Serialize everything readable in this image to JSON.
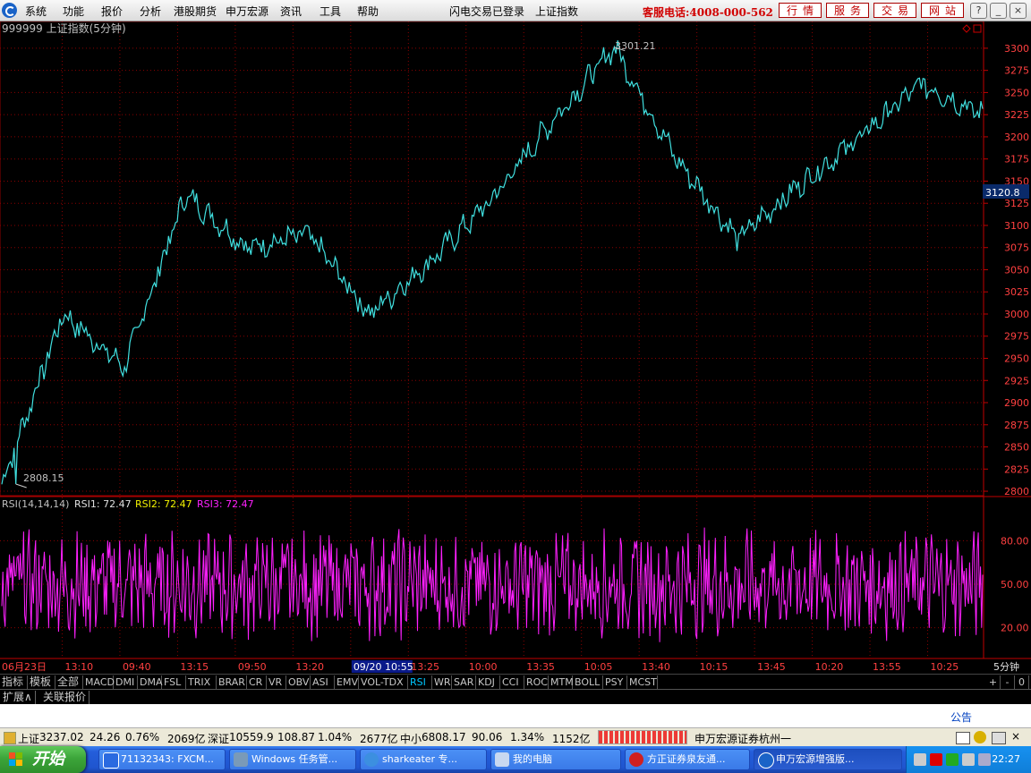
{
  "menu": {
    "items": [
      "系统",
      "功能",
      "报价",
      "分析",
      "港股期货",
      "申万宏源",
      "资讯",
      "工具",
      "帮助"
    ],
    "login_status": "闪电交易已登录",
    "index_name": "上证指数",
    "hotline": "客服电话:4008-000-562",
    "service_buttons": [
      "行情",
      "服务",
      "交易",
      "网站"
    ]
  },
  "chart": {
    "title": "999999 上证指数(5分钟)",
    "price_high_label": "3301.21",
    "price_low_label": "2808.15",
    "current_price": "3120.8",
    "indicator_legend": {
      "name": "RSI(14,14,14)",
      "rsi1": "RSI1: 72.47",
      "rsi2": "RSI2: 72.47",
      "rsi3": "RSI3: 72.47"
    },
    "period_label": "5分钟",
    "time_labels": [
      "06月23日",
      "13:10",
      "09:40",
      "13:15",
      "09:50",
      "13:20",
      "09/20 10:55",
      "13:25",
      "10:00",
      "13:35",
      "10:05",
      "13:40",
      "10:15",
      "13:45",
      "10:20",
      "13:55",
      "10:25"
    ]
  },
  "chart_data": {
    "type": "line",
    "title": "999999 上证指数(5分钟)",
    "price_axis": {
      "ticks": [
        2800,
        2825,
        2850,
        2875,
        2900,
        2925,
        2950,
        2975,
        3000,
        3025,
        3050,
        3075,
        3100,
        3125,
        3150,
        3175,
        3200,
        3225,
        3250,
        3275,
        3300
      ],
      "ylim": [
        2795,
        3310
      ]
    },
    "series": [
      {
        "name": "上证指数",
        "x": [
          "06月23日",
          "13:10",
          "09:40",
          "13:15",
          "09:50",
          "13:20",
          "09/20 10:55",
          "13:25",
          "10:00",
          "13:35",
          "10:05",
          "13:40",
          "10:15",
          "13:45",
          "10:20",
          "13:55",
          "10:25"
        ],
        "values": [
          2808,
          3000,
          2940,
          3135,
          3075,
          3090,
          3000,
          3060,
          3130,
          3220,
          3301,
          3175,
          3085,
          3145,
          3200,
          3260,
          3225
        ],
        "color": "#40e0e0"
      }
    ],
    "annotations": [
      {
        "label": "3301.21",
        "value": 3301.21
      },
      {
        "label": "2808.15",
        "value": 2808.15
      },
      {
        "label": "3120.8",
        "value": 3120.8
      }
    ],
    "rsi": {
      "name": "RSI(14,14,14)",
      "ticks": [
        20,
        50,
        80
      ],
      "ylim": [
        0,
        100
      ],
      "latest": {
        "RSI1": 72.47,
        "RSI2": 72.47,
        "RSI3": 72.47
      },
      "color": "#ff20ff"
    },
    "grid": true
  },
  "tabs": [
    "指标",
    "模板",
    "全部",
    "MACD",
    "DMI",
    "DMA",
    "FSL",
    "TRIX",
    "BRAR",
    "CR",
    "VR",
    "OBV",
    "ASI",
    "EMV",
    "VOL-TDX",
    "RSI",
    "WR",
    "SAR",
    "KDJ",
    "CCI",
    "ROC",
    "MTM",
    "BOLL",
    "PSY",
    "MCST"
  ],
  "active_tab": "RSI",
  "tab_controls": [
    "+",
    "-",
    "0"
  ],
  "sub_tabs": [
    "扩展∧",
    "关联报价"
  ],
  "notice": "公告",
  "status": {
    "sh": {
      "name": "上证",
      "price": "3237.02",
      "change": "24.26",
      "pct": "0.76%",
      "amount": "2069亿"
    },
    "sz": {
      "name": "深证",
      "price": "10559.9",
      "change": "108.87",
      "pct": "1.04%",
      "amount": "2677亿"
    },
    "zx": {
      "name": "中小",
      "price": "6808.17",
      "change": "90.06",
      "pct": "1.34%",
      "amount": "1152亿"
    },
    "broker": "申万宏源证券杭州一"
  },
  "taskbar": {
    "start": "开始",
    "tasks": [
      "71132343: FXCM...",
      "Windows 任务管...",
      "sharkeater 专...",
      "我的电脑",
      "方正证券泉友通...",
      "申万宏源增强版..."
    ],
    "clock": "22:27"
  },
  "colors": {
    "grid": "#8b0000",
    "price": "#40e0e0",
    "rsi": "#ff20ff",
    "axis_text": "#ff4040",
    "accent": "#c00000"
  }
}
